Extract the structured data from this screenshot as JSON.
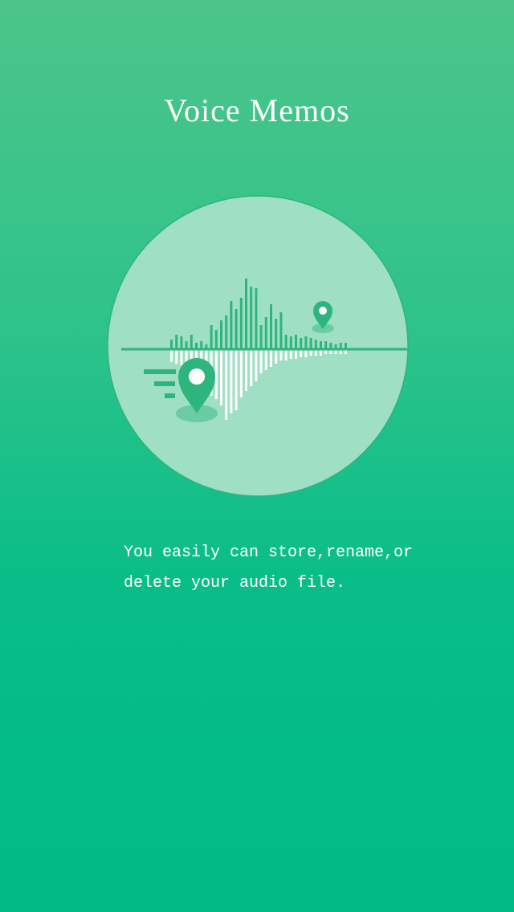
{
  "onboarding": {
    "title": "Voice Memos",
    "description_line1": "You easily can store,rename,or",
    "description_line2": "delete your audio file.",
    "illustration_icon": "audio-waveform-with-location-pins-icon"
  },
  "colors": {
    "background_top": "#4cc58a",
    "background_bottom": "#00bb86",
    "circle_fill": "#9fdfc4",
    "accent_green": "#2db57d",
    "text": "#ffffff"
  }
}
